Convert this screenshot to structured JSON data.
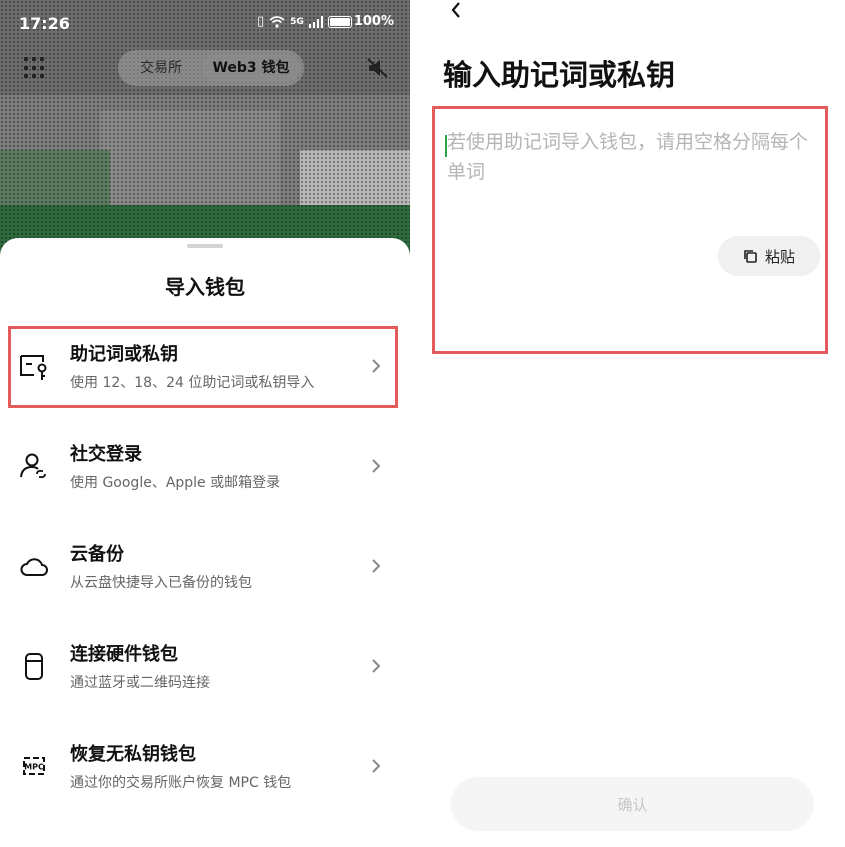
{
  "status_bar": {
    "time": "17:26",
    "signal_label": "5G",
    "battery": "100%"
  },
  "top_bar": {
    "tab_exchange": "交易所",
    "tab_web3": "Web3 钱包"
  },
  "import_sheet": {
    "title": "导入钱包",
    "options": [
      {
        "title": "助记词或私钥",
        "subtitle": "使用 12、18、24 位助记词或私钥导入",
        "icon": "key-wallet-icon"
      },
      {
        "title": "社交登录",
        "subtitle": "使用 Google、Apple 或邮箱登录",
        "icon": "social-login-icon"
      },
      {
        "title": "云备份",
        "subtitle": "从云盘快捷导入已备份的钱包",
        "icon": "cloud-icon"
      },
      {
        "title": "连接硬件钱包",
        "subtitle": "通过蓝牙或二维码连接",
        "icon": "hardware-wallet-icon"
      },
      {
        "title": "恢复无私钥钱包",
        "subtitle": "通过你的交易所账户恢复 MPC 钱包",
        "icon": "mpc-icon",
        "icon_text": "MPC"
      }
    ]
  },
  "import_page": {
    "title": "输入助记词或私钥",
    "input_value": "",
    "input_placeholder": "若使用助记词导入钱包，请用空格分隔每个单词",
    "paste_label": "粘贴",
    "confirm_label": "确认"
  },
  "colors": {
    "highlight": "#e35b5b",
    "cursor": "#2aa34a"
  }
}
